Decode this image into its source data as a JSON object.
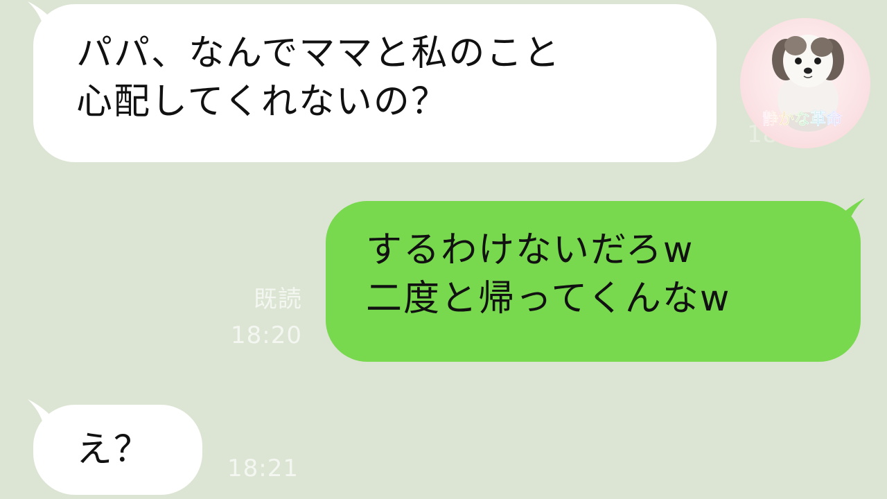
{
  "chat": {
    "messages": [
      {
        "direction": "incoming",
        "lines": [
          "パパ、なんでママと私のこと",
          "心配してくれないの？"
        ],
        "time": "18:19"
      },
      {
        "direction": "outgoing",
        "lines": [
          "するわけないだろw",
          "二度と帰ってくんなw"
        ],
        "read": "既読",
        "time": "18:20"
      },
      {
        "direction": "incoming",
        "lines": [
          "え？"
        ],
        "time": "18:21"
      }
    ]
  },
  "avatar": {
    "icon": "puppy-avatar-icon",
    "logo_text": "静かな革命"
  },
  "colors": {
    "background": "#dce5d3",
    "incoming_bubble": "#ffffff",
    "outgoing_bubble": "#78d84e",
    "meta_text": "#f4f7f1"
  }
}
